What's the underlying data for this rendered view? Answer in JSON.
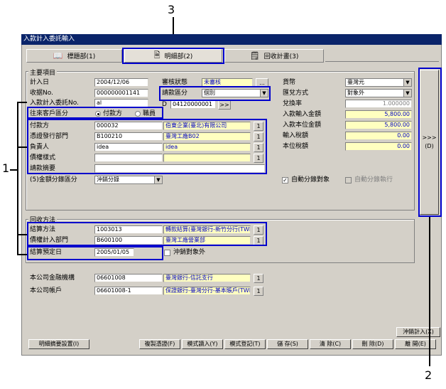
{
  "window_title": "入款計入委託輸入",
  "tabs": [
    {
      "label": "標題部(1)"
    },
    {
      "label": "明細部(2)"
    },
    {
      "label": "回收計畫(3)"
    }
  ],
  "main_group": {
    "label": "主要項目",
    "entry_date": {
      "label": "計入日",
      "value": "2004/12/06"
    },
    "receipt_no": {
      "label": "收据No.",
      "value": "000000001141"
    },
    "commission_no": {
      "label": "入款計入委託No.",
      "value": "al"
    },
    "counterparty_type": {
      "label": "往來客戶區分",
      "option1": "付款方",
      "option2": "職員"
    },
    "payer": {
      "label": "付款方",
      "code": "000032",
      "name": "伯東企業(臺北)有限公司"
    },
    "issuing_dept": {
      "label": "憑證發行部門",
      "code": "B100210",
      "name": "臺灣工廠B02"
    },
    "person": {
      "label": "負責人",
      "code": "idea",
      "name": "idea"
    },
    "claim_pattern": {
      "label": "債權樣式"
    },
    "note": {
      "label": "請款摘要"
    },
    "amount_split": {
      "label": "(5)金額分錄區分",
      "value": "沖銷分錄"
    },
    "review_status": {
      "label": "審核狀態",
      "value": "未審核",
      "button": "..."
    },
    "billing_type": {
      "label": "請款區分",
      "value": "個別"
    },
    "d_code": {
      "label": "D",
      "value": "04120000001",
      "button": ">>"
    },
    "currency": {
      "label": "貨幣",
      "value": "臺灣元"
    },
    "fx_method": {
      "label": "匯兌方式",
      "value": "對象外"
    },
    "fx_rate": {
      "label": "兌換率",
      "value": "1.000000"
    },
    "input_amount": {
      "label": "入款輸入金額",
      "value": "5,800.00"
    },
    "local_amount": {
      "label": "入款本位金額",
      "value": "5,800.00"
    },
    "input_tax": {
      "label": "輸入稅額",
      "value": "0.00"
    },
    "local_tax": {
      "label": "本位稅額",
      "value": "0.00"
    },
    "auto_split": {
      "label": "自動分錄對象",
      "checked": "✓"
    },
    "auto_split_exec": {
      "label": "自動分錄執行"
    }
  },
  "side_button": {
    "label": ">>>",
    "sub": "(D)"
  },
  "collection_group": {
    "label": "回收方法",
    "settle_method": {
      "label": "結算方法",
      "code": "1003013",
      "name": "轉款結算(臺灣銀行-新竹分行(TWD))"
    },
    "claim_dept": {
      "label": "債權計入部門",
      "code": "B600100",
      "name": "臺灣工廠營業部"
    },
    "settle_date": {
      "label": "結算預定日",
      "value": "2005/01/05"
    },
    "offset_exclude": {
      "label": "沖銷對象外"
    }
  },
  "bank": {
    "inst": {
      "label": "本公司金融機構",
      "code": "06601008",
      "name": "臺灣銀行-信託支行"
    },
    "account": {
      "label": "本公司帳戶",
      "code": "06601008-1",
      "name": "保證銀行-臺灣分行-基本賬戶(TWD)"
    }
  },
  "buttons": {
    "detail_settings": "明細摘要設置(I)",
    "copy_voucher": "複製憑證(F)",
    "template_load": "模式讀入(Y)",
    "template_save": "模式登記(T)",
    "save": "儲 存(S)",
    "clear": "清 除(C)",
    "delete": "刪 除(D)",
    "close": "離 開(E)",
    "offset_entry": "沖銷計入(X)"
  },
  "mini_button": "1",
  "callouts": {
    "one": "1",
    "two": "2",
    "three": "3"
  },
  "colors": {
    "title_bg": "#0a246a",
    "highlight": "#0000cc",
    "readonly_bg": "#ffffc0"
  }
}
